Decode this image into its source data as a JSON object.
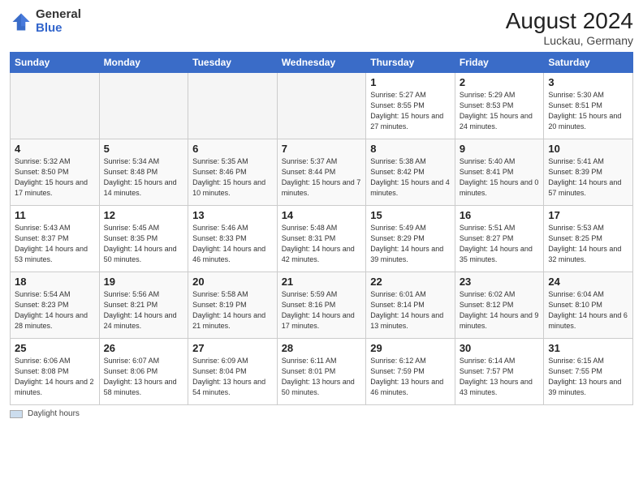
{
  "header": {
    "logo_general": "General",
    "logo_blue": "Blue",
    "month_year": "August 2024",
    "location": "Luckau, Germany"
  },
  "days_of_week": [
    "Sunday",
    "Monday",
    "Tuesday",
    "Wednesday",
    "Thursday",
    "Friday",
    "Saturday"
  ],
  "weeks": [
    [
      {
        "day": "",
        "empty": true
      },
      {
        "day": "",
        "empty": true
      },
      {
        "day": "",
        "empty": true
      },
      {
        "day": "",
        "empty": true
      },
      {
        "day": "1",
        "sunrise": "5:27 AM",
        "sunset": "8:55 PM",
        "daylight": "15 hours and 27 minutes."
      },
      {
        "day": "2",
        "sunrise": "5:29 AM",
        "sunset": "8:53 PM",
        "daylight": "15 hours and 24 minutes."
      },
      {
        "day": "3",
        "sunrise": "5:30 AM",
        "sunset": "8:51 PM",
        "daylight": "15 hours and 20 minutes."
      }
    ],
    [
      {
        "day": "4",
        "sunrise": "5:32 AM",
        "sunset": "8:50 PM",
        "daylight": "15 hours and 17 minutes."
      },
      {
        "day": "5",
        "sunrise": "5:34 AM",
        "sunset": "8:48 PM",
        "daylight": "15 hours and 14 minutes."
      },
      {
        "day": "6",
        "sunrise": "5:35 AM",
        "sunset": "8:46 PM",
        "daylight": "15 hours and 10 minutes."
      },
      {
        "day": "7",
        "sunrise": "5:37 AM",
        "sunset": "8:44 PM",
        "daylight": "15 hours and 7 minutes."
      },
      {
        "day": "8",
        "sunrise": "5:38 AM",
        "sunset": "8:42 PM",
        "daylight": "15 hours and 4 minutes."
      },
      {
        "day": "9",
        "sunrise": "5:40 AM",
        "sunset": "8:41 PM",
        "daylight": "15 hours and 0 minutes."
      },
      {
        "day": "10",
        "sunrise": "5:41 AM",
        "sunset": "8:39 PM",
        "daylight": "14 hours and 57 minutes."
      }
    ],
    [
      {
        "day": "11",
        "sunrise": "5:43 AM",
        "sunset": "8:37 PM",
        "daylight": "14 hours and 53 minutes."
      },
      {
        "day": "12",
        "sunrise": "5:45 AM",
        "sunset": "8:35 PM",
        "daylight": "14 hours and 50 minutes."
      },
      {
        "day": "13",
        "sunrise": "5:46 AM",
        "sunset": "8:33 PM",
        "daylight": "14 hours and 46 minutes."
      },
      {
        "day": "14",
        "sunrise": "5:48 AM",
        "sunset": "8:31 PM",
        "daylight": "14 hours and 42 minutes."
      },
      {
        "day": "15",
        "sunrise": "5:49 AM",
        "sunset": "8:29 PM",
        "daylight": "14 hours and 39 minutes."
      },
      {
        "day": "16",
        "sunrise": "5:51 AM",
        "sunset": "8:27 PM",
        "daylight": "14 hours and 35 minutes."
      },
      {
        "day": "17",
        "sunrise": "5:53 AM",
        "sunset": "8:25 PM",
        "daylight": "14 hours and 32 minutes."
      }
    ],
    [
      {
        "day": "18",
        "sunrise": "5:54 AM",
        "sunset": "8:23 PM",
        "daylight": "14 hours and 28 minutes."
      },
      {
        "day": "19",
        "sunrise": "5:56 AM",
        "sunset": "8:21 PM",
        "daylight": "14 hours and 24 minutes."
      },
      {
        "day": "20",
        "sunrise": "5:58 AM",
        "sunset": "8:19 PM",
        "daylight": "14 hours and 21 minutes."
      },
      {
        "day": "21",
        "sunrise": "5:59 AM",
        "sunset": "8:16 PM",
        "daylight": "14 hours and 17 minutes."
      },
      {
        "day": "22",
        "sunrise": "6:01 AM",
        "sunset": "8:14 PM",
        "daylight": "14 hours and 13 minutes."
      },
      {
        "day": "23",
        "sunrise": "6:02 AM",
        "sunset": "8:12 PM",
        "daylight": "14 hours and 9 minutes."
      },
      {
        "day": "24",
        "sunrise": "6:04 AM",
        "sunset": "8:10 PM",
        "daylight": "14 hours and 6 minutes."
      }
    ],
    [
      {
        "day": "25",
        "sunrise": "6:06 AM",
        "sunset": "8:08 PM",
        "daylight": "14 hours and 2 minutes."
      },
      {
        "day": "26",
        "sunrise": "6:07 AM",
        "sunset": "8:06 PM",
        "daylight": "13 hours and 58 minutes."
      },
      {
        "day": "27",
        "sunrise": "6:09 AM",
        "sunset": "8:04 PM",
        "daylight": "13 hours and 54 minutes."
      },
      {
        "day": "28",
        "sunrise": "6:11 AM",
        "sunset": "8:01 PM",
        "daylight": "13 hours and 50 minutes."
      },
      {
        "day": "29",
        "sunrise": "6:12 AM",
        "sunset": "7:59 PM",
        "daylight": "13 hours and 46 minutes."
      },
      {
        "day": "30",
        "sunrise": "6:14 AM",
        "sunset": "7:57 PM",
        "daylight": "13 hours and 43 minutes."
      },
      {
        "day": "31",
        "sunrise": "6:15 AM",
        "sunset": "7:55 PM",
        "daylight": "13 hours and 39 minutes."
      }
    ]
  ],
  "footnote": {
    "box_label": "Daylight hours"
  }
}
